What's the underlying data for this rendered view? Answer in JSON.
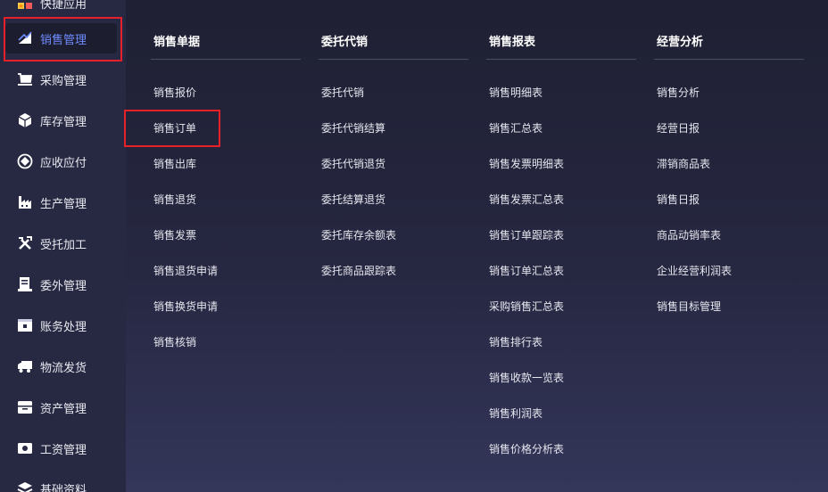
{
  "sidebar": {
    "items": [
      {
        "label": "快捷应用",
        "icon": "star-apps-icon"
      },
      {
        "label": "销售管理",
        "icon": "sales-chart-icon"
      },
      {
        "label": "采购管理",
        "icon": "cart-icon"
      },
      {
        "label": "库存管理",
        "icon": "box-icon"
      },
      {
        "label": "应收应付",
        "icon": "receivable-icon"
      },
      {
        "label": "生产管理",
        "icon": "factory-icon"
      },
      {
        "label": "受托加工",
        "icon": "tools-icon"
      },
      {
        "label": "委外管理",
        "icon": "outsource-icon"
      },
      {
        "label": "账务处理",
        "icon": "ledger-icon"
      },
      {
        "label": "物流发货",
        "icon": "truck-icon"
      },
      {
        "label": "资产管理",
        "icon": "asset-icon"
      },
      {
        "label": "工资管理",
        "icon": "salary-icon"
      },
      {
        "label": "基础资料",
        "icon": "layers-icon"
      }
    ]
  },
  "menu": {
    "columns": [
      {
        "title": "销售单据",
        "items": [
          "销售报价",
          "销售订单",
          "销售出库",
          "销售退货",
          "销售发票",
          "销售退货申请",
          "销售换货申请",
          "销售核销"
        ]
      },
      {
        "title": "委托代销",
        "items": [
          "委托代销",
          "委托代销结算",
          "委托代销退货",
          "委托结算退货",
          "委托库存余额表",
          "委托商品跟踪表"
        ]
      },
      {
        "title": "销售报表",
        "items": [
          "销售明细表",
          "销售汇总表",
          "销售发票明细表",
          "销售发票汇总表",
          "销售订单跟踪表",
          "销售订单汇总表",
          "采购销售汇总表",
          "销售排行表",
          "销售收款一览表",
          "销售利润表",
          "销售价格分析表"
        ]
      },
      {
        "title": "经营分析",
        "items": [
          "销售分析",
          "经营日报",
          "滞销商品表",
          "销售日报",
          "商品动销率表",
          "企业经营利润表",
          "销售目标管理"
        ]
      }
    ]
  },
  "colors": {
    "accent": "#6f8cff",
    "highlight_border": "#e8202a"
  }
}
